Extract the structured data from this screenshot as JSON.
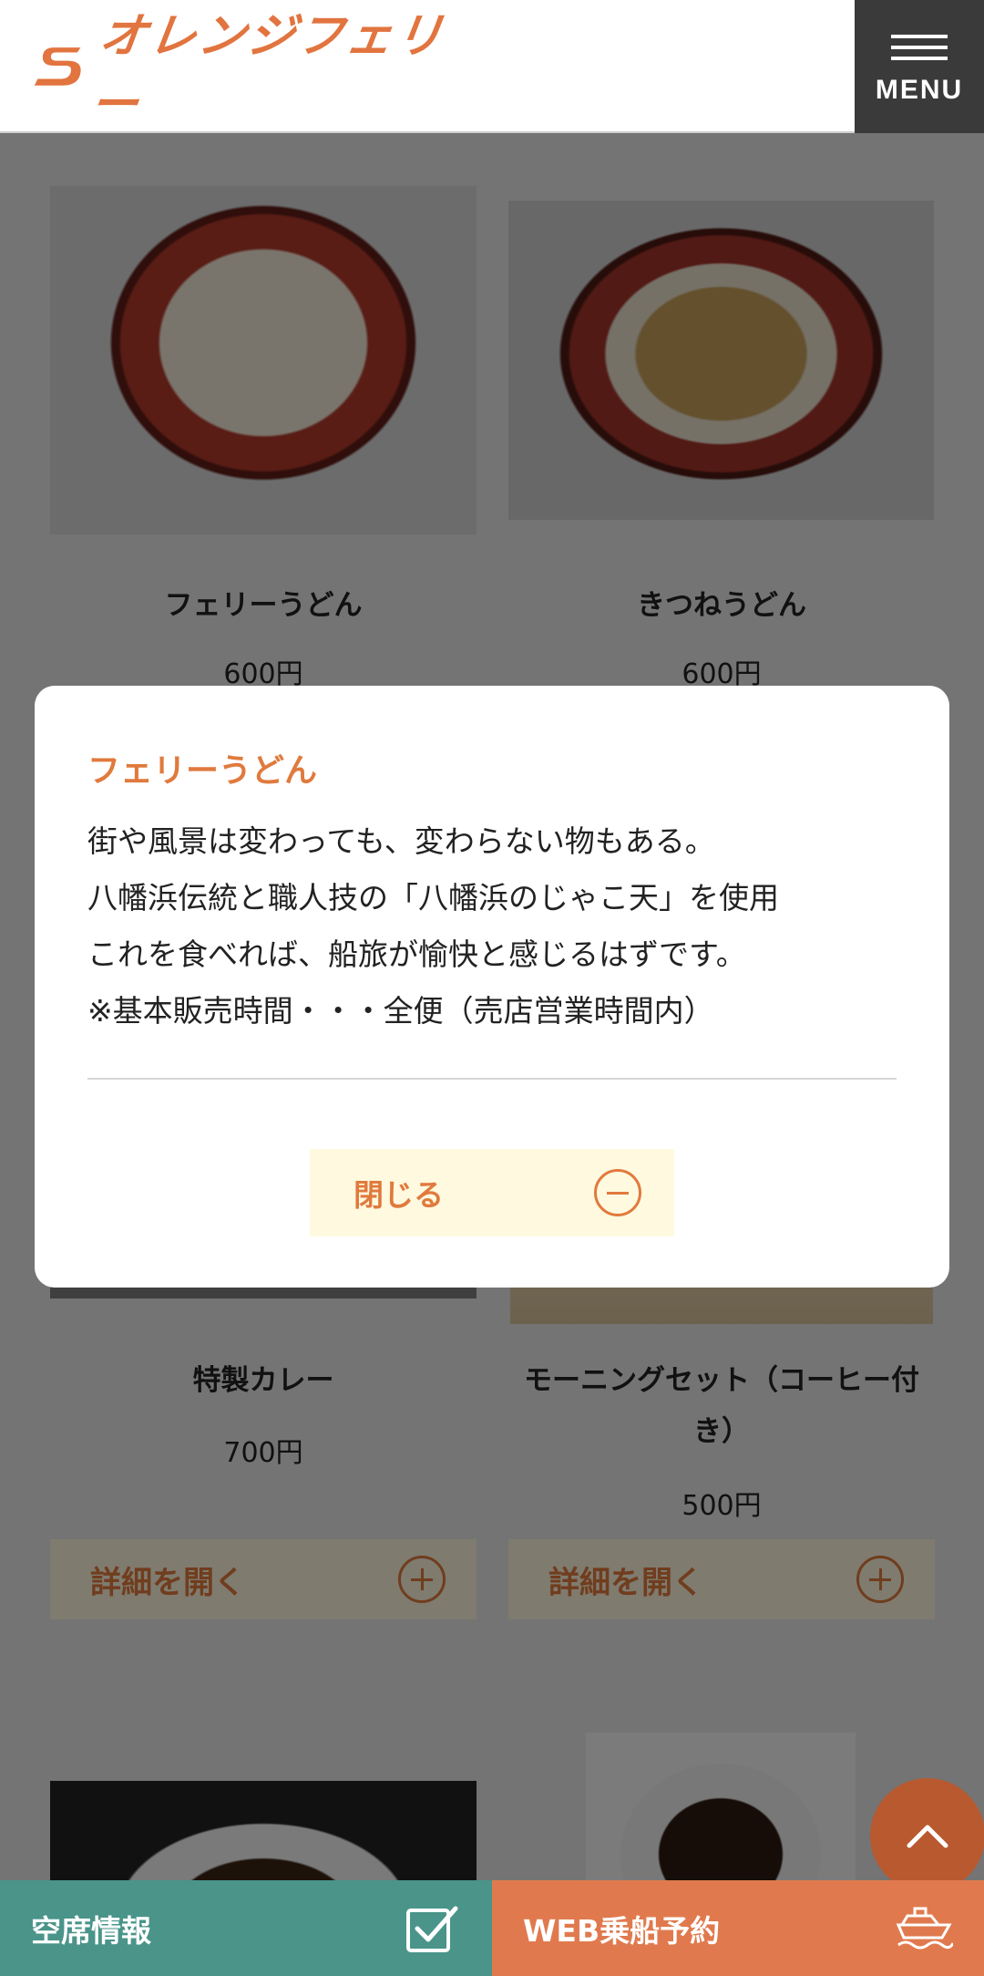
{
  "header": {
    "logo_text": "オレンジフェリー",
    "menu_label": "MENU"
  },
  "products": [
    {
      "name": "フェリーうどん",
      "price": "600円"
    },
    {
      "name": "きつねうどん",
      "price": "600円"
    },
    {
      "name": "特製カレー",
      "price": "700円",
      "detail_label": "詳細を開く"
    },
    {
      "name_line1": "モーニングセット（コーヒー付",
      "name_line2": "き）",
      "price": "500円",
      "detail_label": "詳細を開く"
    }
  ],
  "modal": {
    "title": "フェリーうどん",
    "lines": [
      "街や風景は変わっても、変わらない物もある。",
      "八幡浜伝統と職人技の「八幡浜のじゃこ天」を使用",
      "これを食べれば、船旅が愉快と感じるはずです。",
      "※基本販売時間・・・全便（売店営業時間内）"
    ],
    "close_label": "閉じる"
  },
  "bottom_bar": {
    "seat_label": "空席情報",
    "booking_label": "WEB乗船予約"
  },
  "colors": {
    "accent": "#e07a3d",
    "seat_bar": "#4a948a",
    "booking_bar": "#e07a4e",
    "menu_bg": "#3a3a3a"
  },
  "icons": {
    "logo": "orange-ferry-logo-icon",
    "menu": "hamburger-icon",
    "detail": "circle-plus-icon",
    "close": "circle-minus-icon",
    "scroll_top": "chevron-up-icon",
    "seat": "checkbox-icon",
    "booking": "ship-icon"
  }
}
